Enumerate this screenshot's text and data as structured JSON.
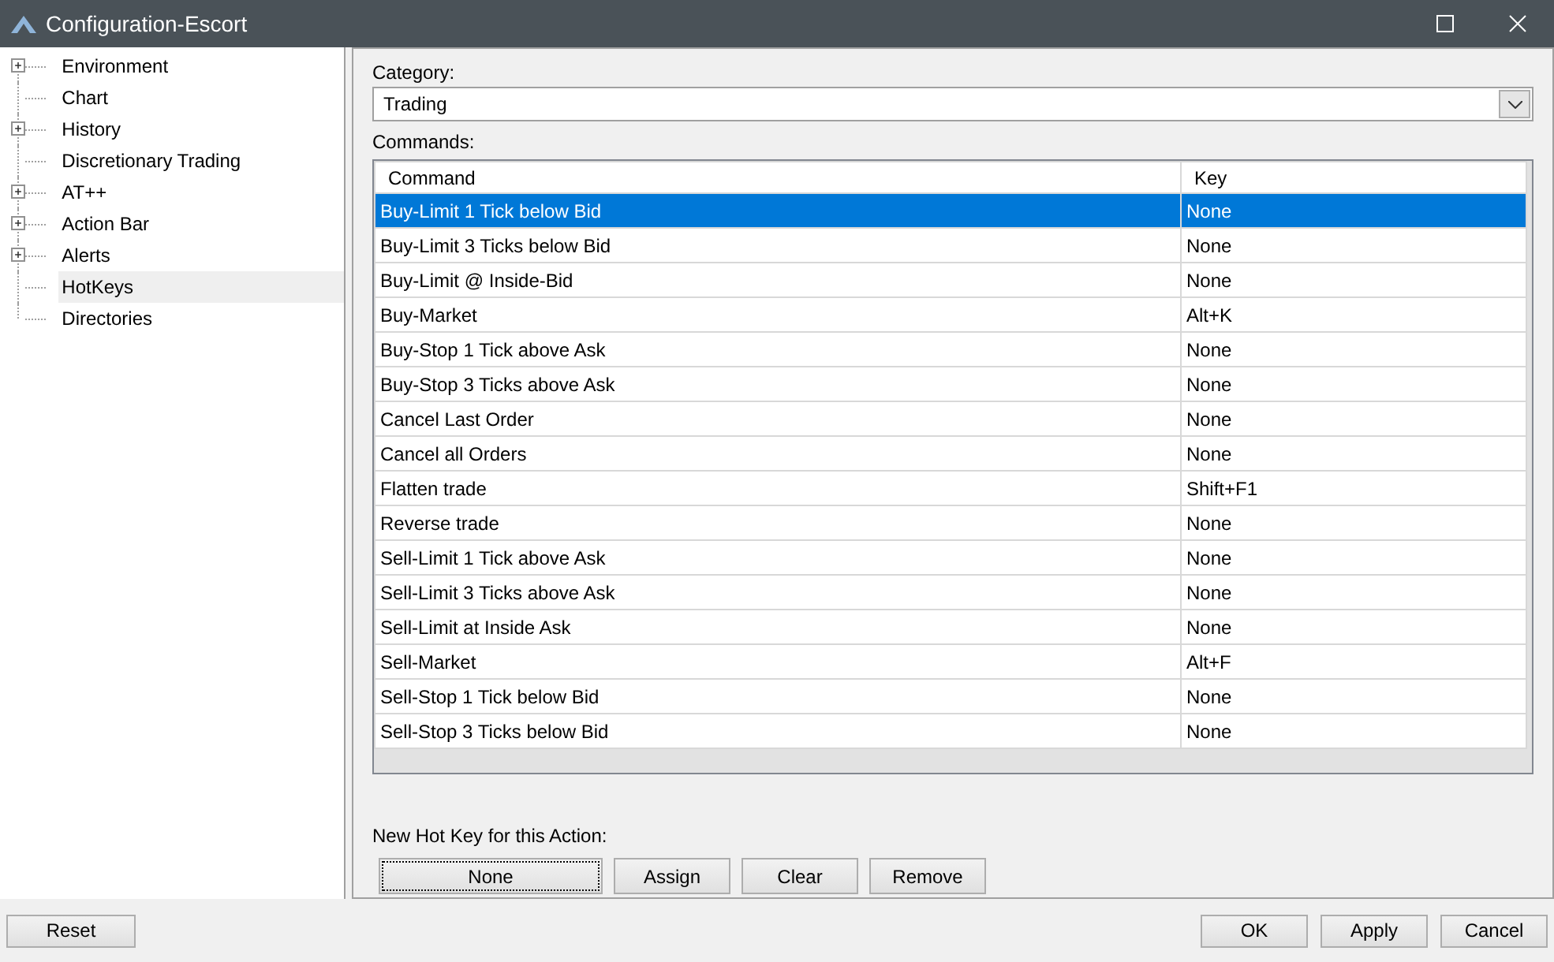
{
  "window": {
    "title": "Configuration-Escort"
  },
  "tree": [
    {
      "label": "Environment",
      "expandable": true,
      "selected": false
    },
    {
      "label": "Chart",
      "expandable": false,
      "selected": false
    },
    {
      "label": "History",
      "expandable": true,
      "selected": false
    },
    {
      "label": "Discretionary Trading",
      "expandable": false,
      "selected": false
    },
    {
      "label": "AT++",
      "expandable": true,
      "selected": false
    },
    {
      "label": "Action Bar",
      "expandable": true,
      "selected": false
    },
    {
      "label": "Alerts",
      "expandable": true,
      "selected": false
    },
    {
      "label": "HotKeys",
      "expandable": false,
      "selected": true
    },
    {
      "label": "Directories",
      "expandable": false,
      "selected": false
    }
  ],
  "category": {
    "label": "Category:",
    "value": "Trading"
  },
  "commands": {
    "label": "Commands:",
    "columns": [
      "Command",
      "Key"
    ],
    "rows": [
      {
        "command": "Buy-Limit 1 Tick below Bid",
        "key": "None",
        "selected": true
      },
      {
        "command": "Buy-Limit 3 Ticks below Bid",
        "key": "None",
        "selected": false
      },
      {
        "command": "Buy-Limit @ Inside-Bid",
        "key": "None",
        "selected": false
      },
      {
        "command": "Buy-Market",
        "key": "Alt+K",
        "selected": false
      },
      {
        "command": "Buy-Stop 1 Tick above Ask",
        "key": "None",
        "selected": false
      },
      {
        "command": "Buy-Stop 3 Ticks above Ask",
        "key": "None",
        "selected": false
      },
      {
        "command": "Cancel Last Order",
        "key": "None",
        "selected": false
      },
      {
        "command": "Cancel all Orders",
        "key": "None",
        "selected": false
      },
      {
        "command": "Flatten trade",
        "key": "Shift+F1",
        "selected": false
      },
      {
        "command": "Reverse trade",
        "key": "None",
        "selected": false
      },
      {
        "command": "Sell-Limit 1 Tick above Ask",
        "key": "None",
        "selected": false
      },
      {
        "command": "Sell-Limit 3 Ticks above Ask",
        "key": "None",
        "selected": false
      },
      {
        "command": "Sell-Limit at Inside Ask",
        "key": "None",
        "selected": false
      },
      {
        "command": "Sell-Market",
        "key": "Alt+F",
        "selected": false
      },
      {
        "command": "Sell-Stop 1 Tick below Bid",
        "key": "None",
        "selected": false
      },
      {
        "command": "Sell-Stop 3 Ticks below Bid",
        "key": "None",
        "selected": false
      }
    ]
  },
  "hotkey": {
    "label": "New Hot Key for this Action:",
    "value": "None",
    "buttons": [
      "Assign",
      "Clear",
      "Remove"
    ]
  },
  "footer": {
    "left_buttons": [
      "Reset"
    ],
    "right_buttons": [
      "OK",
      "Apply",
      "Cancel"
    ]
  }
}
